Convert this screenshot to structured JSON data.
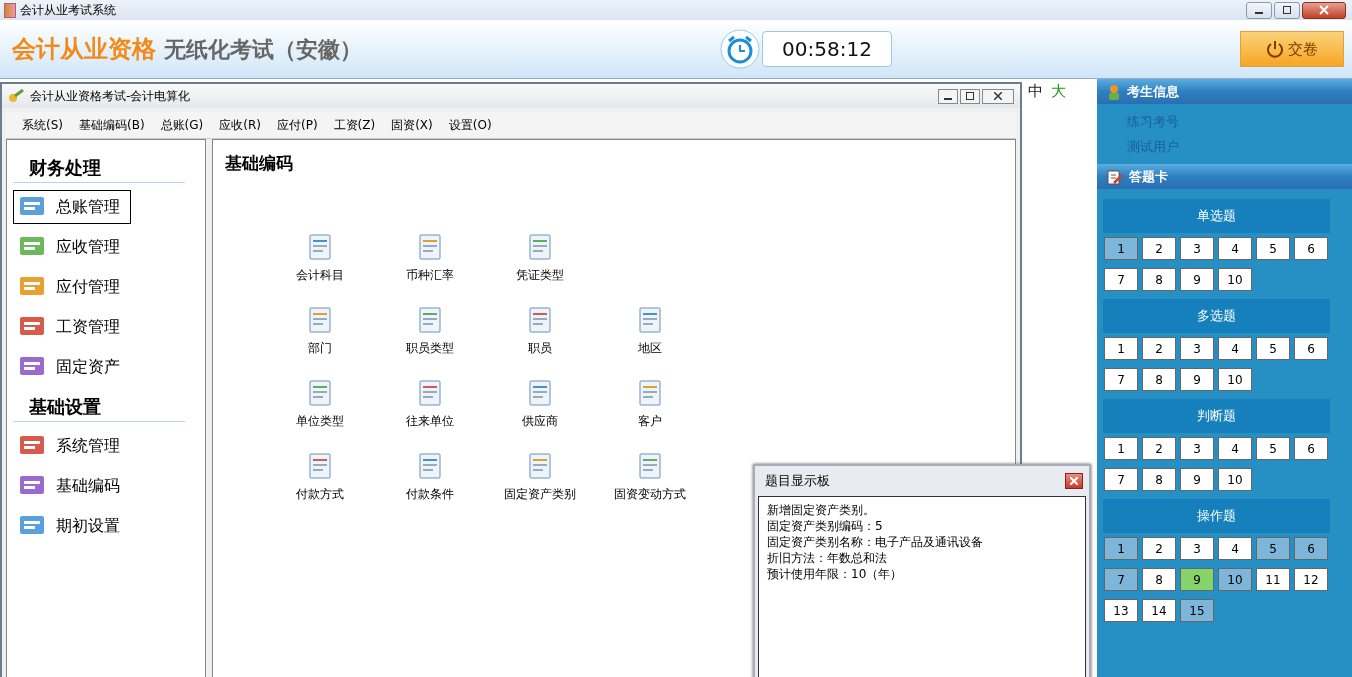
{
  "window": {
    "title": "会计从业考试系统"
  },
  "header": {
    "brand": "会计从业资格",
    "subtitle": "无纸化考试（安徽）",
    "timer": "00:58:12",
    "submit_button": "交卷"
  },
  "font_sizes": [
    {
      "label": "中",
      "selected": false
    },
    {
      "label": "大",
      "selected": true
    }
  ],
  "inner_window": {
    "title": "会计从业资格考试-会计电算化",
    "menu": [
      "系统(S)",
      "基础编码(B)",
      "总账(G)",
      "应收(R)",
      "应付(P)",
      "工资(Z)",
      "固资(X)",
      "设置(O)"
    ],
    "nav_groups": [
      {
        "title": "财务处理",
        "items": [
          {
            "label": "总账管理",
            "selected": true
          },
          {
            "label": "应收管理",
            "selected": false
          },
          {
            "label": "应付管理",
            "selected": false
          },
          {
            "label": "工资管理",
            "selected": false
          },
          {
            "label": "固定资产",
            "selected": false
          }
        ]
      },
      {
        "title": "基础设置",
        "items": [
          {
            "label": "系统管理",
            "selected": false
          },
          {
            "label": "基础编码",
            "selected": false
          },
          {
            "label": "期初设置",
            "selected": false
          }
        ]
      }
    ],
    "content_title": "基础编码",
    "tiles": [
      [
        "会计科目",
        "币种汇率",
        "凭证类型"
      ],
      [
        "部门",
        "职员类型",
        "职员",
        "地区"
      ],
      [
        "单位类型",
        "往来单位",
        "供应商",
        "客户"
      ],
      [
        "付款方式",
        "付款条件",
        "固定资产类别",
        "固资变动方式"
      ]
    ]
  },
  "question_panel": {
    "title": "题目显示板",
    "lines": [
      "新增固定资产类别。",
      "固定资产类别编码：5",
      "固定资产类别名称：电子产品及通讯设备",
      "折旧方法：年数总和法",
      "预计使用年限：10（年）"
    ]
  },
  "candidate_info": {
    "title": "考生信息",
    "items": [
      "练习考号",
      "测试用户"
    ]
  },
  "answer_card": {
    "title": "答题卡",
    "sections": [
      {
        "title": "单选题",
        "questions": [
          {
            "number": "1",
            "answered": true,
            "selected": false
          },
          {
            "number": "2",
            "answered": false,
            "selected": false
          },
          {
            "number": "3",
            "answered": false,
            "selected": false
          },
          {
            "number": "4",
            "answered": false,
            "selected": false
          },
          {
            "number": "5",
            "answered": false,
            "selected": false
          },
          {
            "number": "6",
            "answered": false,
            "selected": false
          },
          {
            "number": "7",
            "answered": false,
            "selected": false
          },
          {
            "number": "8",
            "answered": false,
            "selected": false
          },
          {
            "number": "9",
            "answered": false,
            "selected": false
          },
          {
            "number": "10",
            "answered": false,
            "selected": false
          }
        ]
      },
      {
        "title": "多选题",
        "questions": [
          {
            "number": "1",
            "answered": false,
            "selected": false
          },
          {
            "number": "2",
            "answered": false,
            "selected": false
          },
          {
            "number": "3",
            "answered": false,
            "selected": false
          },
          {
            "number": "4",
            "answered": false,
            "selected": false
          },
          {
            "number": "5",
            "answered": false,
            "selected": false
          },
          {
            "number": "6",
            "answered": false,
            "selected": false
          },
          {
            "number": "7",
            "answered": false,
            "selected": false
          },
          {
            "number": "8",
            "answered": false,
            "selected": false
          },
          {
            "number": "9",
            "answered": false,
            "selected": false
          },
          {
            "number": "10",
            "answered": false,
            "selected": false
          }
        ]
      },
      {
        "title": "判断题",
        "questions": [
          {
            "number": "1",
            "answered": false,
            "selected": false
          },
          {
            "number": "2",
            "answered": false,
            "selected": false
          },
          {
            "number": "3",
            "answered": false,
            "selected": false
          },
          {
            "number": "4",
            "answered": false,
            "selected": false
          },
          {
            "number": "5",
            "answered": false,
            "selected": false
          },
          {
            "number": "6",
            "answered": false,
            "selected": false
          },
          {
            "number": "7",
            "answered": false,
            "selected": false
          },
          {
            "number": "8",
            "answered": false,
            "selected": false
          },
          {
            "number": "9",
            "answered": false,
            "selected": false
          },
          {
            "number": "10",
            "answered": false,
            "selected": false
          }
        ]
      },
      {
        "title": "操作题",
        "questions": [
          {
            "number": "1",
            "answered": true,
            "selected": false
          },
          {
            "number": "2",
            "answered": false,
            "selected": false
          },
          {
            "number": "3",
            "answered": false,
            "selected": false
          },
          {
            "number": "4",
            "answered": false,
            "selected": false
          },
          {
            "number": "5",
            "answered": true,
            "selected": false
          },
          {
            "number": "6",
            "answered": true,
            "selected": false
          },
          {
            "number": "7",
            "answered": true,
            "selected": false
          },
          {
            "number": "8",
            "answered": false,
            "selected": false
          },
          {
            "number": "9",
            "answered": false,
            "selected": true
          },
          {
            "number": "10",
            "answered": true,
            "selected": false
          },
          {
            "number": "11",
            "answered": false,
            "selected": false
          },
          {
            "number": "12",
            "answered": false,
            "selected": false
          },
          {
            "number": "13",
            "answered": false,
            "selected": false
          },
          {
            "number": "14",
            "answered": false,
            "selected": false
          },
          {
            "number": "15",
            "answered": true,
            "selected": false
          }
        ]
      }
    ]
  }
}
